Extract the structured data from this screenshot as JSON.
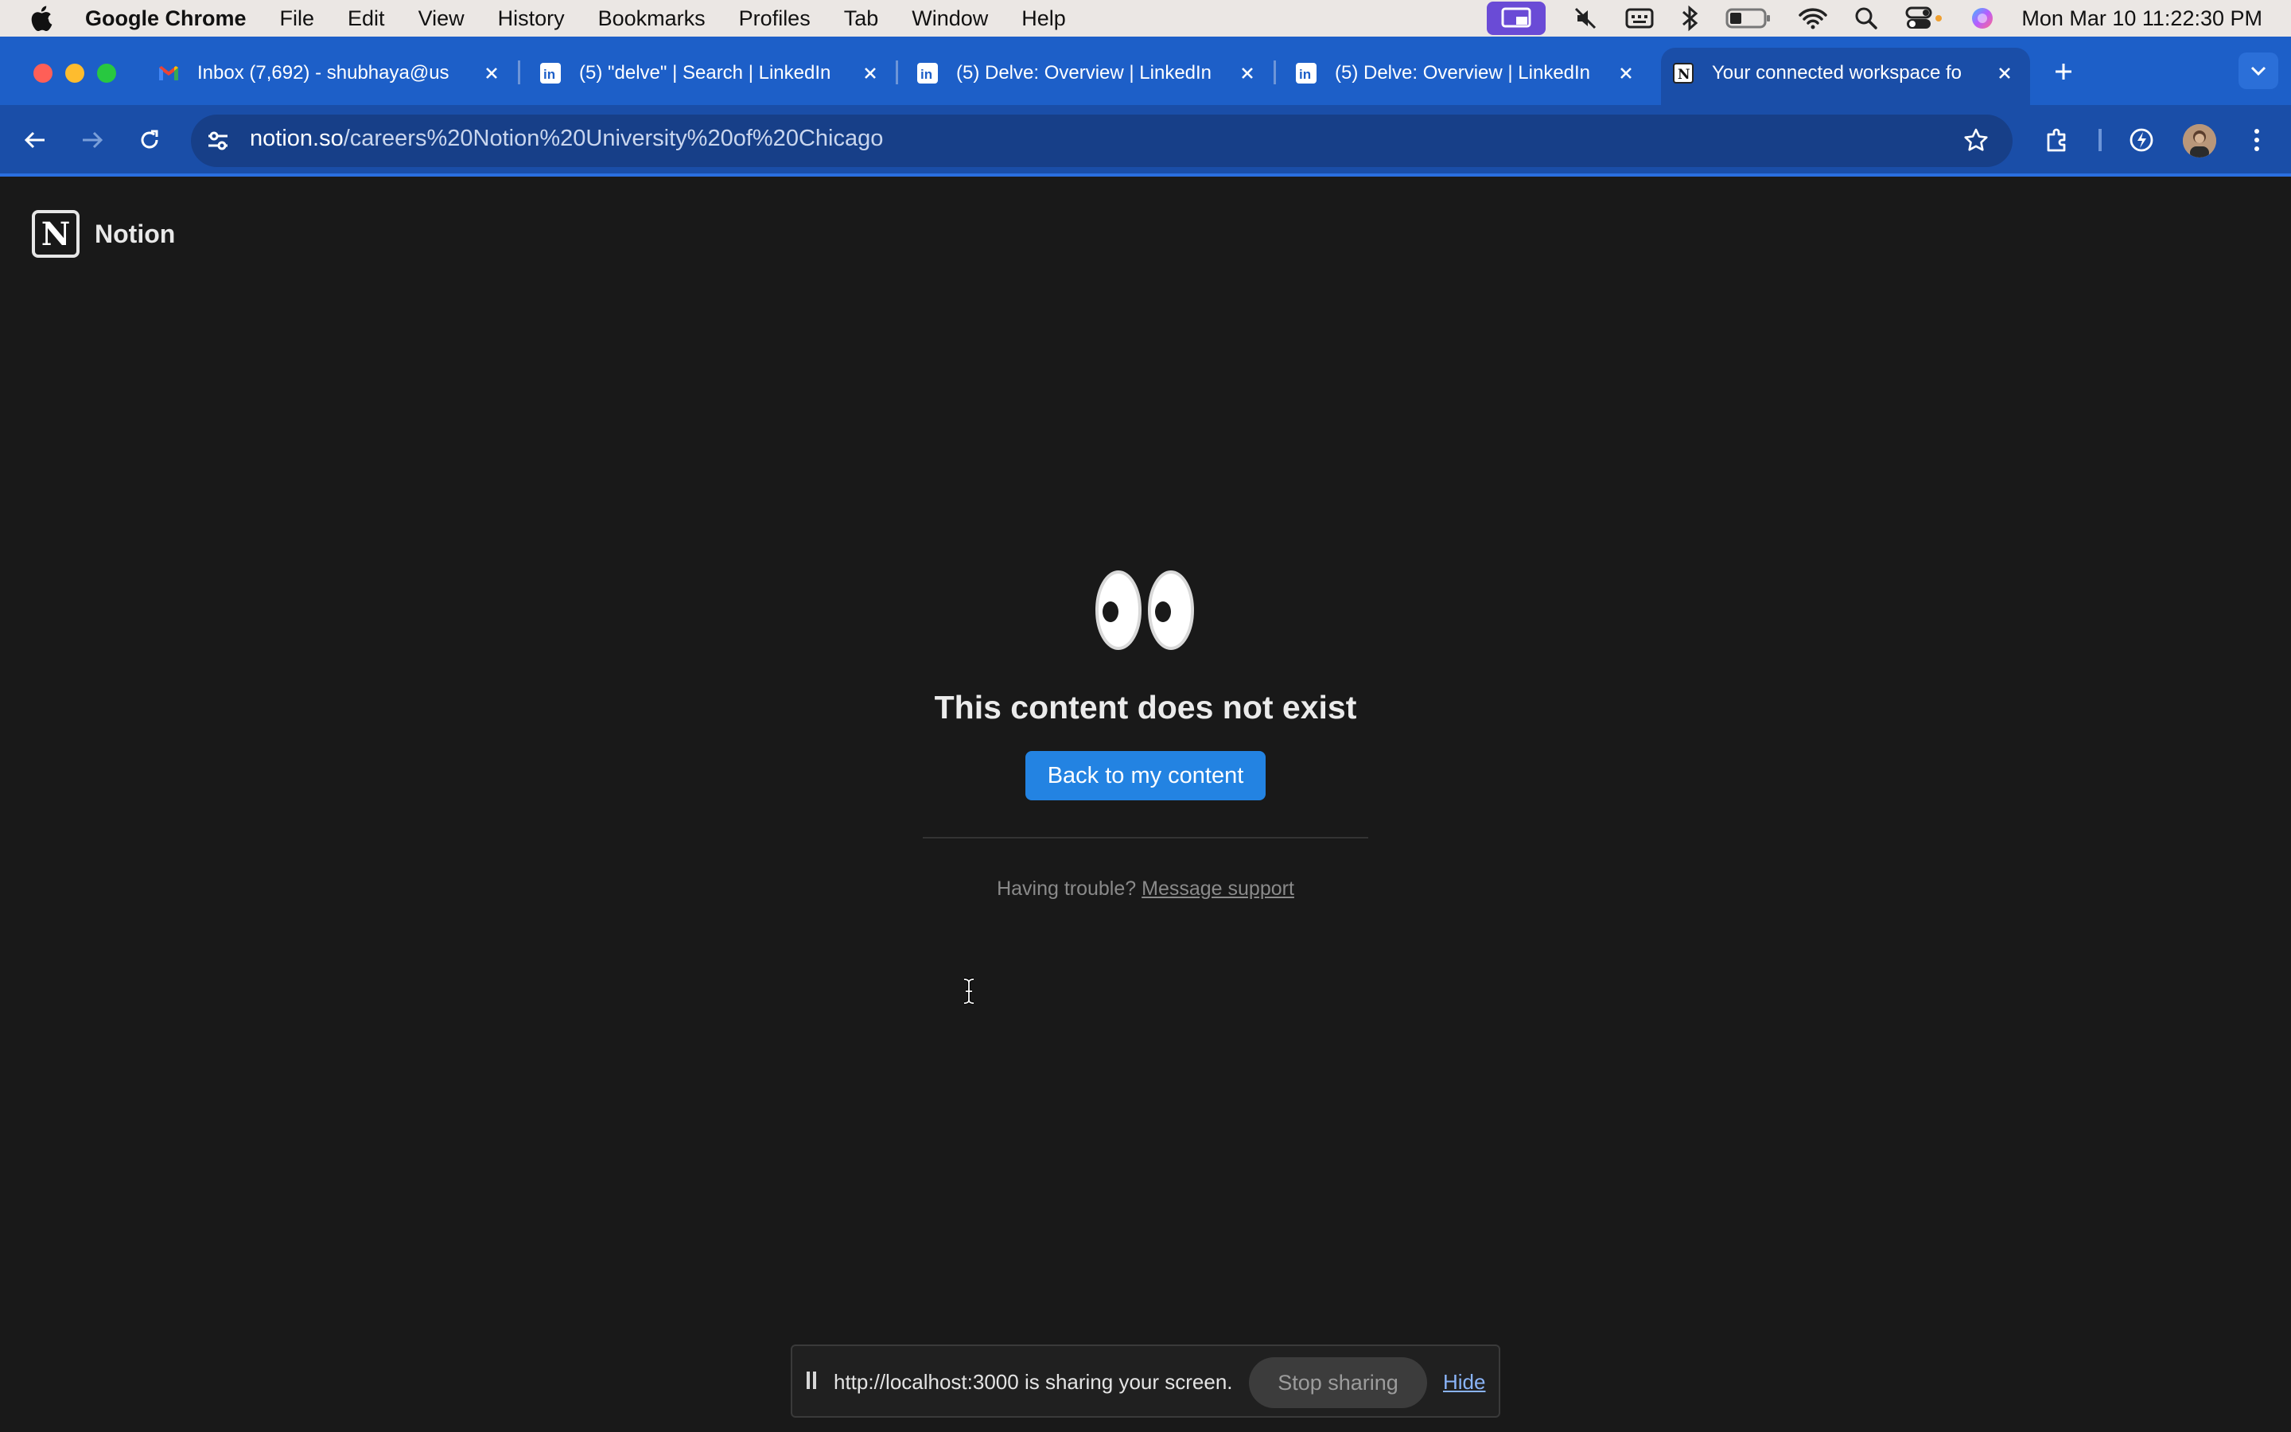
{
  "menubar": {
    "app_name": "Google Chrome",
    "items": [
      "File",
      "Edit",
      "View",
      "History",
      "Bookmarks",
      "Profiles",
      "Tab",
      "Window",
      "Help"
    ],
    "clock": "Mon Mar 10  11:22:30 PM"
  },
  "tabs": [
    {
      "title": "Inbox (7,692) - shubhaya@us",
      "icon": "gmail-icon"
    },
    {
      "title": "(5) \"delve\" | Search | LinkedIn",
      "icon": "linkedin-icon"
    },
    {
      "title": "(5) Delve: Overview | LinkedIn",
      "icon": "linkedin-icon"
    },
    {
      "title": "(5) Delve: Overview | LinkedIn",
      "icon": "linkedin-icon"
    },
    {
      "title": "Your connected workspace fo",
      "icon": "notion-icon",
      "active": true
    }
  ],
  "address_bar": {
    "host": "notion.so",
    "path": "/careers%20Notion%20University%20of%20Chicago"
  },
  "notion": {
    "logo_letter": "N",
    "brand": "Notion",
    "title": "This content does not exist",
    "back_button": "Back to my content",
    "trouble_text": "Having trouble?",
    "support_link": "Message support"
  },
  "share_bar": {
    "message": "http://localhost:3000 is sharing your screen.",
    "stop_label": "Stop sharing",
    "hide_label": "Hide"
  },
  "colors": {
    "tab_strip": "#1d5fc8",
    "page_bg": "#191919",
    "primary_button": "#2383e2"
  }
}
